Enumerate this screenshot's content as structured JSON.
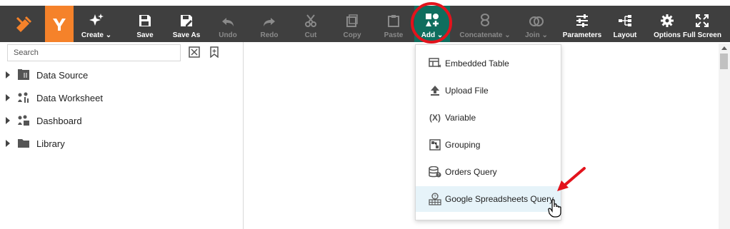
{
  "toolbar": {
    "create": "Create",
    "save": "Save",
    "save_as": "Save As",
    "undo": "Undo",
    "redo": "Redo",
    "cut": "Cut",
    "copy": "Copy",
    "paste": "Paste",
    "add": "Add",
    "concatenate": "Concatenate",
    "join": "Join",
    "parameters": "Parameters",
    "layout": "Layout",
    "options": "Options",
    "full_screen": "Full Screen"
  },
  "search": {
    "placeholder": "Search"
  },
  "tree": [
    {
      "label": "Data Source",
      "icon": "database-icon"
    },
    {
      "label": "Data Worksheet",
      "icon": "worksheet-icon"
    },
    {
      "label": "Dashboard",
      "icon": "dashboard-icon"
    },
    {
      "label": "Library",
      "icon": "folder-icon"
    }
  ],
  "add_menu": [
    {
      "label": "Embedded Table",
      "icon": "embedded-table-icon"
    },
    {
      "label": "Upload File",
      "icon": "upload-icon"
    },
    {
      "label": "Variable",
      "icon": "variable-icon"
    },
    {
      "label": "Grouping",
      "icon": "grouping-icon"
    },
    {
      "label": "Orders Query",
      "icon": "database-query-icon"
    },
    {
      "label": "Google Spreadsheets Query",
      "icon": "spreadsheet-query-icon"
    }
  ],
  "colors": {
    "toolbar_bg": "#3f3f3f",
    "brand_orange": "#f5822a",
    "active_teal": "#0f6e5e",
    "highlight_red": "#e3131c",
    "hover_blue": "#e6f3f9"
  }
}
